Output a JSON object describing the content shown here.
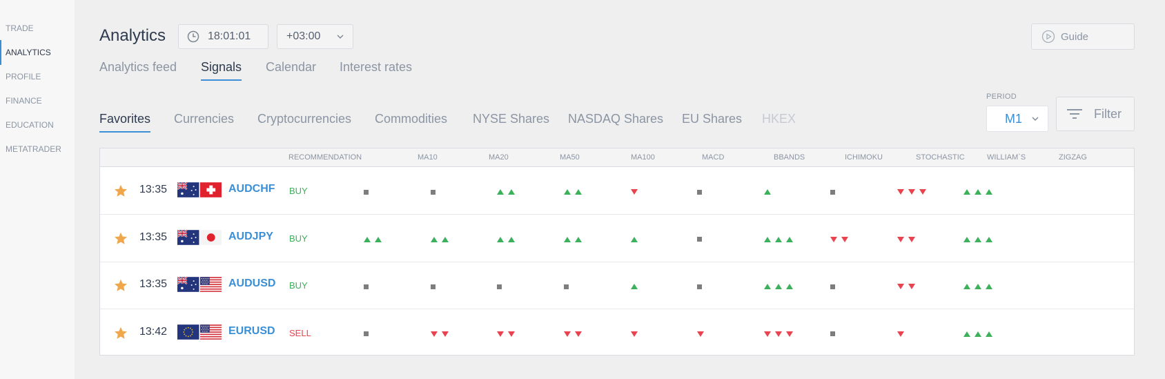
{
  "sidebar": {
    "items": [
      {
        "label": "TRADE",
        "active": false
      },
      {
        "label": "ANALYTICS",
        "active": true
      },
      {
        "label": "PROFILE",
        "active": false
      },
      {
        "label": "FINANCE",
        "active": false
      },
      {
        "label": "EDUCATION",
        "active": false
      },
      {
        "label": "METATRADER",
        "active": false
      }
    ]
  },
  "header": {
    "title": "Analytics",
    "time": "18:01:01",
    "timezone": "+03:00",
    "guide_label": "Guide"
  },
  "main_tabs": [
    "Analytics feed",
    "Signals",
    "Calendar",
    "Interest rates"
  ],
  "main_tab_active": "Signals",
  "sub_tabs": [
    "Favorites",
    "Currencies",
    "Cryptocurrencies",
    "Commodities",
    "NYSE Shares",
    "NASDAQ Shares",
    "EU Shares",
    "HKEX"
  ],
  "sub_tab_active": "Favorites",
  "period": {
    "label": "PERIOD",
    "value": "M1"
  },
  "filter_label": "Filter",
  "table": {
    "columns": [
      "RECOMMENDATION",
      "MA10",
      "MA20",
      "MA50",
      "MA100",
      "MACD",
      "BBANDS",
      "ICHIMOKU",
      "STOCHASTIC",
      "WILLIAM`S",
      "ZIGZAG"
    ],
    "rows": [
      {
        "time": "13:35",
        "pair": "AUDCHF",
        "flags": [
          "australia",
          "switzerland"
        ],
        "recommendation": "BUY",
        "signals": [
          "n",
          "n",
          "uu",
          "uu",
          "d",
          "n",
          "u",
          "n",
          "ddd",
          "uuu"
        ]
      },
      {
        "time": "13:35",
        "pair": "AUDJPY",
        "flags": [
          "australia",
          "japan"
        ],
        "recommendation": "BUY",
        "signals": [
          "uu",
          "uu",
          "uu",
          "uu",
          "u",
          "n",
          "uuu",
          "dd",
          "dd",
          "uuu"
        ]
      },
      {
        "time": "13:35",
        "pair": "AUDUSD",
        "flags": [
          "australia",
          "usa"
        ],
        "recommendation": "BUY",
        "signals": [
          "n",
          "n",
          "n",
          "n",
          "u",
          "n",
          "uuu",
          "n",
          "dd",
          "uuu"
        ]
      },
      {
        "time": "13:42",
        "pair": "EURUSD",
        "flags": [
          "eu",
          "usa"
        ],
        "recommendation": "SELL",
        "signals": [
          "n",
          "dd",
          "dd",
          "dd",
          "d",
          "d",
          "ddd",
          "n",
          "d",
          "uuu"
        ]
      }
    ]
  },
  "colors": {
    "accent": "#3a8fd6",
    "buy": "#3cb05a",
    "sell": "#e8434f",
    "star": "#f0a64a"
  },
  "icons": {
    "clock": "clock-icon",
    "chevron": "chevron-down-icon",
    "guide": "play-circle-icon",
    "filter": "filter-icon",
    "favorite": "star-icon"
  }
}
